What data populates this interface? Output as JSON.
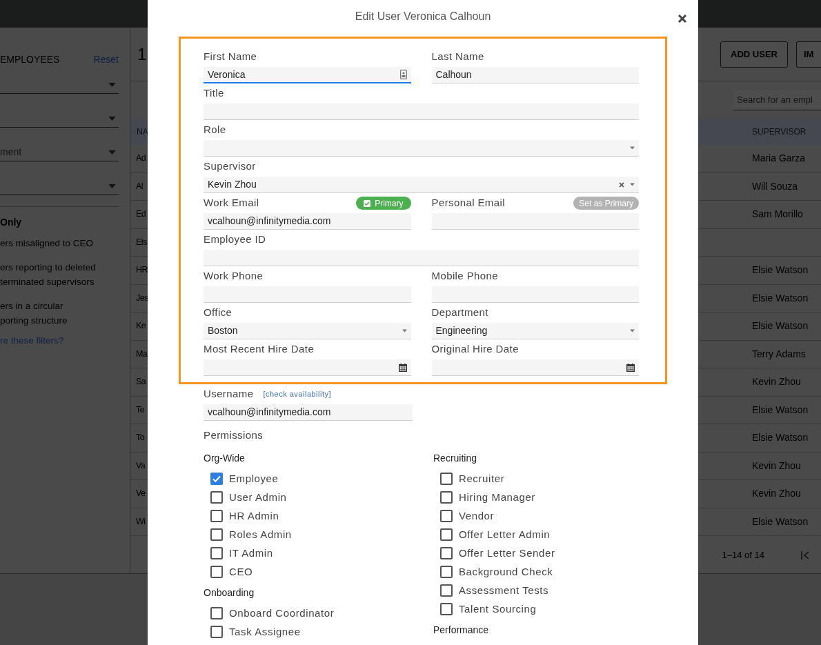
{
  "app": {
    "sidebar": {
      "heading": "EMPLOYEES",
      "reset": "Reset",
      "filters": [
        {
          "kind": "dropdown"
        },
        {
          "kind": "dropdown"
        },
        {
          "kind": "dropdown",
          "placeholder": "ment"
        },
        {
          "kind": "dropdown"
        }
      ],
      "section_title": "Only",
      "options": [
        {
          "lines": [
            "ers misaligned to CEO"
          ]
        },
        {
          "lines": [
            "ers reporting to deleted",
            "terminated supervisors"
          ]
        },
        {
          "lines": [
            "ers in a circular",
            "porting structure"
          ]
        }
      ],
      "help_link": "re these filters?"
    },
    "count": "1",
    "buttons": [
      "ADD USER",
      "IM"
    ],
    "search": {
      "placeholder": "Search for an empl"
    },
    "table": {
      "columns": [
        "NA",
        "SUPERVISOR"
      ],
      "rows": [
        {
          "name": "Ad",
          "supervisor": "Maria Garza"
        },
        {
          "name": "Al",
          "supervisor": "Will Souza"
        },
        {
          "name": "Ed",
          "supervisor": "Sam Morillo"
        },
        {
          "name": "Els"
        },
        {
          "name": "HR",
          "supervisor": "Elsie Watson"
        },
        {
          "name": "Jes",
          "supervisor": "Elsie Watson"
        },
        {
          "name": "Ke",
          "supervisor": "Elsie Watson"
        },
        {
          "name": "Ma",
          "supervisor": "Terry Adams"
        },
        {
          "name": "Sa",
          "supervisor": "Kevin Zhou"
        },
        {
          "name": "Te",
          "supervisor": "Elsie Watson"
        },
        {
          "name": "To",
          "supervisor": "Elsie Watson"
        },
        {
          "name": "Va",
          "supervisor": "Kevin Zhou"
        },
        {
          "name": "Ve",
          "supervisor": "Kevin Zhou"
        },
        {
          "name": "Wi",
          "supervisor": "Elsie Watson"
        }
      ]
    },
    "pagination": "1–14 of 14"
  },
  "modal": {
    "title": "Edit User Veronica Calhoun",
    "fields": [
      {
        "label": "First Name",
        "value": "Veronica",
        "kind": "text",
        "wide": false,
        "focused": true,
        "autofill_icon": true
      },
      {
        "label": "Last Name",
        "value": "Calhoun",
        "kind": "text",
        "wide": false,
        "focused": false
      },
      {
        "label": "Title",
        "kind": "text",
        "wide": true,
        "focused": false
      },
      {
        "label": "Role",
        "kind": "select",
        "wide": true,
        "focused": false
      },
      {
        "label": "Supervisor",
        "value": "Kevin Zhou",
        "kind": "select",
        "wide": true,
        "focused": false,
        "clearable": true
      },
      {
        "label": "Work Email",
        "value": "vcalhoun@infinitymedia.com",
        "kind": "text",
        "wide": false,
        "focused": false,
        "badge": {
          "label": "Primary",
          "selected": true
        }
      },
      {
        "label": "Personal Email",
        "kind": "text",
        "wide": false,
        "focused": false,
        "badge": {
          "label": "Set as Primary",
          "selected": false
        }
      },
      {
        "label": "Employee ID",
        "kind": "text",
        "wide": true,
        "focused": false
      },
      {
        "label": "Work Phone",
        "kind": "text",
        "wide": false,
        "focused": false
      },
      {
        "label": "Mobile Phone",
        "kind": "text",
        "wide": false,
        "focused": false
      },
      {
        "label": "Office",
        "value": "Boston",
        "kind": "select",
        "wide": false,
        "focused": false
      },
      {
        "label": "Department",
        "value": "Engineering",
        "kind": "select",
        "wide": false,
        "focused": false
      },
      {
        "label": "Most Recent Hire Date",
        "kind": "date",
        "wide": false,
        "focused": false
      },
      {
        "label": "Original Hire Date",
        "kind": "date",
        "wide": false,
        "focused": false
      }
    ],
    "username": {
      "label": "Username",
      "link": "[check availability]",
      "value": "vcalhoun@infinitymedia.com"
    },
    "permissions": {
      "title": "Permissions",
      "columns": [
        [
          {
            "title": "Org-Wide",
            "items": [
              {
                "label": "Employee",
                "checked": true
              },
              {
                "label": "User Admin",
                "checked": false
              },
              {
                "label": "HR Admin",
                "checked": false
              },
              {
                "label": "Roles Admin",
                "checked": false
              },
              {
                "label": "IT Admin",
                "checked": false
              },
              {
                "label": "CEO",
                "checked": false
              }
            ]
          },
          {
            "title": "Onboarding",
            "items": [
              {
                "label": "Onboard Coordinator",
                "checked": false
              },
              {
                "label": "Task Assignee",
                "checked": false
              }
            ]
          }
        ],
        [
          {
            "title": "Recruiting",
            "items": [
              {
                "label": "Recruiter",
                "checked": false
              },
              {
                "label": "Hiring Manager",
                "checked": false
              },
              {
                "label": "Vendor",
                "checked": false
              },
              {
                "label": "Offer Letter Admin",
                "checked": false
              },
              {
                "label": "Offer Letter Sender",
                "checked": false
              },
              {
                "label": "Background Check",
                "checked": false
              },
              {
                "label": "Assessment Tests",
                "checked": false
              },
              {
                "label": "Talent Sourcing",
                "checked": false
              }
            ]
          },
          {
            "title": "Performance"
          }
        ]
      ]
    }
  }
}
